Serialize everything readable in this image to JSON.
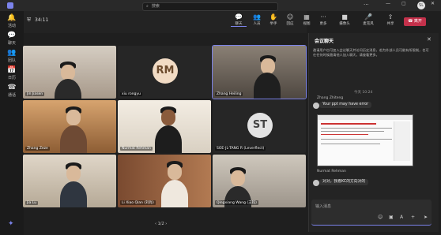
{
  "topbar": {
    "search_icon": "search-icon",
    "search_label": "搜索",
    "more": "···",
    "avatar_initials": "SL",
    "minimize": "—",
    "maximize": "▢",
    "close": "✕"
  },
  "rail": [
    {
      "icon": "activity-icon",
      "glyph": "🔔",
      "label": "活动"
    },
    {
      "icon": "chat-icon",
      "glyph": "💬",
      "label": "聊天"
    },
    {
      "icon": "teams-icon",
      "glyph": "👥",
      "label": "团队"
    },
    {
      "icon": "calendar-icon",
      "glyph": "📅",
      "label": "日历"
    },
    {
      "icon": "calls-icon",
      "glyph": "☎",
      "label": "通话"
    },
    {
      "icon": "apps-icon",
      "glyph": "✦",
      "label": ""
    }
  ],
  "meeting": {
    "timer": "34:11",
    "tools": [
      {
        "icon": "chat-icon",
        "glyph": "💬",
        "label": "聊天"
      },
      {
        "icon": "people-icon",
        "glyph": "👥",
        "label": "人员"
      },
      {
        "icon": "raise-hand-icon",
        "glyph": "✋",
        "label": "举手"
      },
      {
        "icon": "react-icon",
        "glyph": "☺",
        "label": "回应"
      },
      {
        "icon": "view-icon",
        "glyph": "▦",
        "label": "视图"
      },
      {
        "icon": "more-icon",
        "glyph": "···",
        "label": "更多"
      },
      {
        "icon": "camera-icon",
        "glyph": "■",
        "label": "摄像头"
      },
      {
        "icon": "mic-icon",
        "glyph": "🎤",
        "label": "麦克风"
      },
      {
        "icon": "share-icon",
        "glyph": "⇪",
        "label": "共享"
      }
    ],
    "leave_label": "离开"
  },
  "participants": [
    {
      "name": "Jin Jiasen",
      "initials": "",
      "bg": "#bfb3a6"
    },
    {
      "name": "xiu rongyu",
      "initials": "RM",
      "bg": "#2b2b2b"
    },
    {
      "name": "Zhang Heiling",
      "initials": "",
      "bg": "#6f655b"
    },
    {
      "name": "Zhang Zeze",
      "initials": "",
      "bg": "#c49460"
    },
    {
      "name": "Nurmat Rehman",
      "initials": "",
      "bg": "#efe8dc"
    },
    {
      "name": "SOE-JL-TANG R (Leverflect)",
      "initials": "ST",
      "bg": "#2b2b2b"
    },
    {
      "name": "Jia Lu",
      "initials": "",
      "bg": "#d8cbb8"
    },
    {
      "name": "Li Xiao Qian (刘肖)",
      "initials": "",
      "bg": "#8c5a3c"
    },
    {
      "name": "Qingxiang Wang (王钧)",
      "initials": "",
      "bg": "#bdb6ab"
    }
  ],
  "pager": "‹  1/2  ›",
  "chat": {
    "title": "会议聊天",
    "notice": "邀请用户也可加入会议聊天并访问历史消息，若为外部人员可能有所限制，也可在任何时候邀请他人加入聊天，请查看更多。",
    "day": "今天 10:24",
    "messages": [
      {
        "sender": "Zhang Zhiteng",
        "text": "Your ppt may have error"
      },
      {
        "sender": "Nurmat Rehman",
        "text": "对对，我看KC的方向对的"
      }
    ],
    "compose_placeholder": "输入消息"
  },
  "colors": {
    "accent": "#7b83eb",
    "leave": "#c4314b"
  }
}
